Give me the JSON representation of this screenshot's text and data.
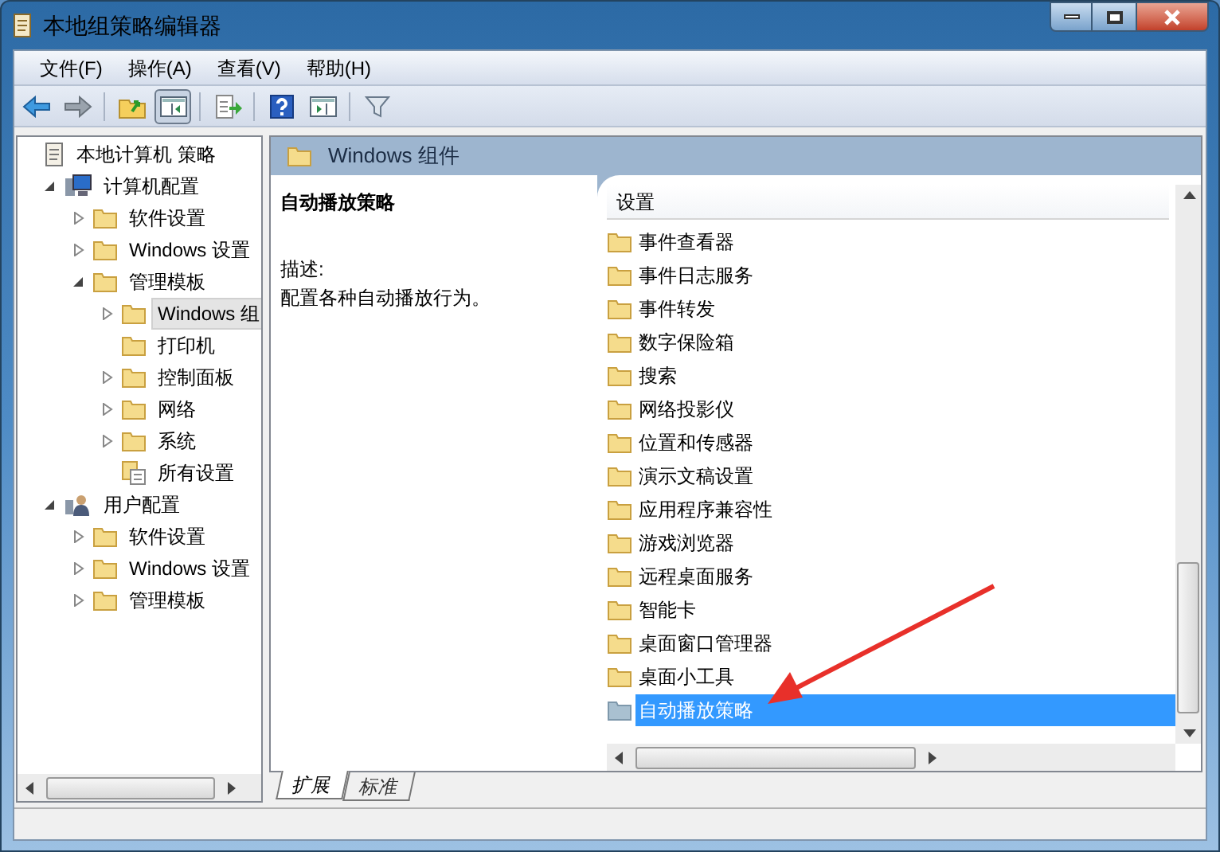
{
  "window": {
    "title": "本地组策略编辑器"
  },
  "menu": [
    "文件(F)",
    "操作(A)",
    "查看(V)",
    "帮助(H)"
  ],
  "toolbar": [
    {
      "kind": "back"
    },
    {
      "kind": "forward"
    },
    {
      "kind": "sep"
    },
    {
      "kind": "up"
    },
    {
      "kind": "pane",
      "selected": true
    },
    {
      "kind": "sep"
    },
    {
      "kind": "export"
    },
    {
      "kind": "sep"
    },
    {
      "kind": "help"
    },
    {
      "kind": "panel",
      "selected": false
    },
    {
      "kind": "sep"
    },
    {
      "kind": "filter"
    }
  ],
  "tree": [
    {
      "label": "本地计算机 策略",
      "kind": "policy",
      "selected": false,
      "children": [
        {
          "label": "计算机配置",
          "kind": "computer",
          "expanded": true,
          "selected": false,
          "children": [
            {
              "label": "软件设置",
              "expanded": false,
              "selected": false
            },
            {
              "label": "Windows 设置",
              "expanded": false,
              "selected": false
            },
            {
              "label": "管理模板",
              "expanded": true,
              "selected": false,
              "children": [
                {
                  "label": "Windows 组",
                  "expanded": false,
                  "selected": true
                },
                {
                  "label": "打印机",
                  "selected": false
                },
                {
                  "label": "控制面板",
                  "expanded": false,
                  "selected": false
                },
                {
                  "label": "网络",
                  "expanded": false,
                  "selected": false
                },
                {
                  "label": "系统",
                  "expanded": false,
                  "selected": false
                },
                {
                  "label": "所有设置",
                  "kind": "settings",
                  "selected": false
                }
              ]
            }
          ]
        },
        {
          "label": "用户配置",
          "kind": "user",
          "expanded": true,
          "selected": false,
          "children": [
            {
              "label": "软件设置",
              "expanded": false,
              "selected": false
            },
            {
              "label": "Windows 设置",
              "expanded": false,
              "selected": false
            },
            {
              "label": "管理模板",
              "expanded": false,
              "selected": false
            }
          ]
        }
      ]
    }
  ],
  "header": {
    "title": "Windows 组件"
  },
  "description": {
    "title": "自动播放策略",
    "label": "描述:",
    "text": "配置各种自动播放行为。"
  },
  "list": {
    "column": "设置",
    "rows": [
      {
        "label": "事件查看器",
        "selected": false
      },
      {
        "label": "事件日志服务",
        "selected": false
      },
      {
        "label": "事件转发",
        "selected": false
      },
      {
        "label": "数字保险箱",
        "selected": false
      },
      {
        "label": "搜索",
        "selected": false
      },
      {
        "label": "网络投影仪",
        "selected": false
      },
      {
        "label": "位置和传感器",
        "selected": false
      },
      {
        "label": "演示文稿设置",
        "selected": false
      },
      {
        "label": "应用程序兼容性",
        "selected": false
      },
      {
        "label": "游戏浏览器",
        "selected": false
      },
      {
        "label": "远程桌面服务",
        "selected": false
      },
      {
        "label": "智能卡",
        "selected": false
      },
      {
        "label": "桌面窗口管理器",
        "selected": false
      },
      {
        "label": "桌面小工具",
        "selected": false
      },
      {
        "label": "自动播放策略",
        "selected": true
      }
    ]
  },
  "tabs": [
    {
      "label": "扩展",
      "selected": true
    },
    {
      "label": "标准",
      "selected": false
    }
  ],
  "annotations": [
    {
      "kind": "arrow"
    }
  ]
}
